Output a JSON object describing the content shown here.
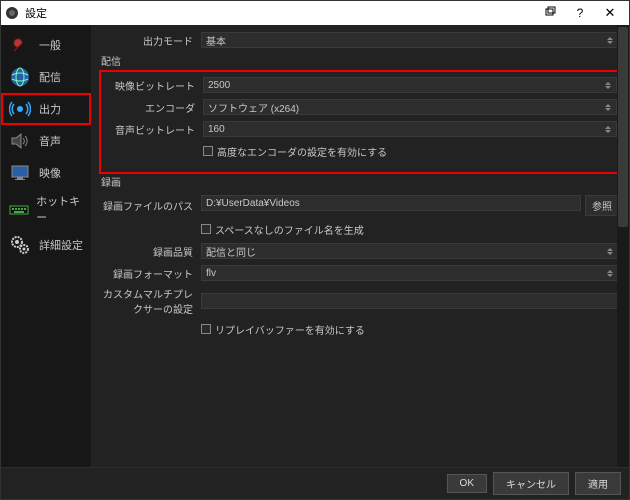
{
  "titlebar": {
    "title": "設定",
    "help": "?",
    "close": "✕"
  },
  "sidebar": {
    "items": [
      {
        "label": "一般",
        "icon": "general"
      },
      {
        "label": "配信",
        "icon": "stream"
      },
      {
        "label": "出力",
        "icon": "output",
        "highlight": true
      },
      {
        "label": "音声",
        "icon": "audio"
      },
      {
        "label": "映像",
        "icon": "video"
      },
      {
        "label": "ホットキー",
        "icon": "hotkey"
      },
      {
        "label": "詳細設定",
        "icon": "advanced"
      }
    ]
  },
  "output_mode": {
    "label": "出力モード",
    "value": "基本"
  },
  "stream_section": {
    "title": "配信"
  },
  "stream": {
    "video_bitrate": {
      "label": "映像ビットレート",
      "value": "2500"
    },
    "encoder": {
      "label": "エンコーダ",
      "value": "ソフトウェア (x264)"
    },
    "audio_bitrate": {
      "label": "音声ビットレート",
      "value": "160"
    },
    "advanced_encoder": {
      "label": "高度なエンコーダの設定を有効にする"
    }
  },
  "record_section": {
    "title": "録画"
  },
  "record": {
    "path": {
      "label": "録画ファイルのパス",
      "value": "D:¥UserData¥Videos",
      "browse": "参照"
    },
    "no_space": {
      "label": "スペースなしのファイル名を生成"
    },
    "quality": {
      "label": "録画品質",
      "value": "配信と同じ"
    },
    "format": {
      "label": "録画フォーマット",
      "value": "flv"
    },
    "mux": {
      "label": "カスタムマルチプレクサーの設定",
      "value": ""
    },
    "replay": {
      "label": "リプレイバッファーを有効にする"
    }
  },
  "footer": {
    "ok": "OK",
    "cancel": "キャンセル",
    "apply": "適用"
  },
  "colors": {
    "highlight": "#e00"
  }
}
